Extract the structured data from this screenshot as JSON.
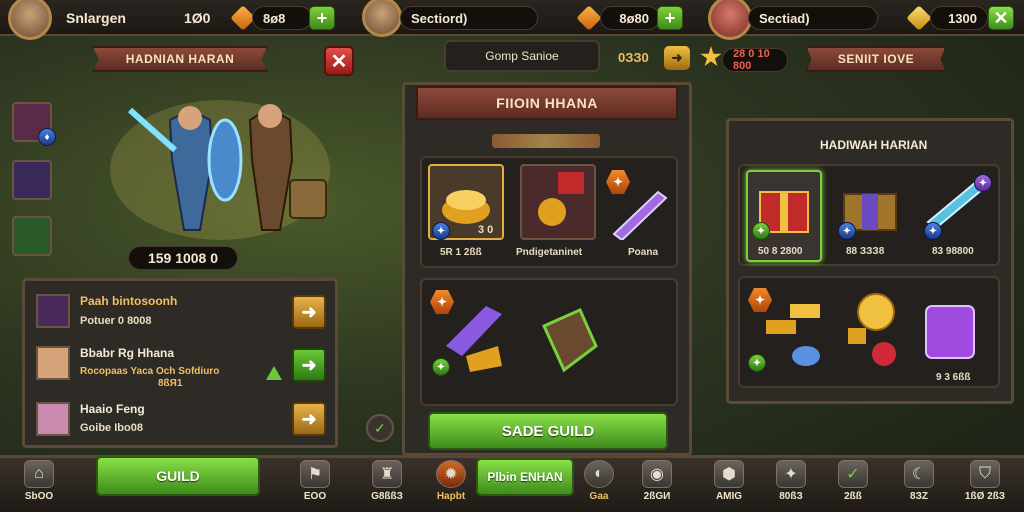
{
  "topbar": {
    "player_name": "Snlargen",
    "level": "1Ø0",
    "currency1": "8ø8",
    "friend1_name": "Sectiord)",
    "currency2": "8ø80",
    "friend2_name": "Sectiad)",
    "currency3": "1300"
  },
  "left": {
    "banner": "HADNIAN HARAN",
    "power": "159 1008 0",
    "list": [
      {
        "title": "Paah bintosoonh",
        "sub": "Potuer 0 8008"
      },
      {
        "title": "Bbabr Rg Hhana",
        "sub": "Rocopaas Yaca Och Sofdiuro",
        "sub2": "8ßЯ1"
      },
      {
        "title": "Haaio Feng",
        "sub": "Goibe Ibo08"
      }
    ]
  },
  "center": {
    "tab": "Gomp Sanioe",
    "timer": "0ЗЗ0",
    "gold_value": "28 0 10 800",
    "panel_title": "FIIOIN HHANA",
    "cards": [
      {
        "label": "5R 1 2ßß",
        "count": "3 0"
      },
      {
        "label": "Pndigetaninet"
      },
      {
        "label": "Poana"
      }
    ],
    "button": "SADE GUILD"
  },
  "right": {
    "banner": "SENIIT IOVE",
    "panel_title": "HADIWAH HARIAN",
    "cards": [
      {
        "label": "50 8 2800"
      },
      {
        "label": "88 ЗЗЗ8"
      },
      {
        "label": "83 98800"
      }
    ],
    "footer_value": "9 3 6ßß"
  },
  "bottombar": {
    "items": [
      {
        "label": "SbOO"
      },
      {
        "label": "GUILD"
      },
      {
        "label": "EОО"
      },
      {
        "label": "G8ßßЗ"
      },
      {
        "label": "Hapbt"
      },
      {
        "label": "Plbin ENHAN"
      },
      {
        "label": "Gaa"
      },
      {
        "label": "2ßGИ"
      },
      {
        "label": "AMIG"
      },
      {
        "label": "80ßЗ"
      },
      {
        "label": "2ßß"
      },
      {
        "label": "8ЗZ"
      },
      {
        "label": "1ßØ 2ßЗ"
      }
    ]
  }
}
